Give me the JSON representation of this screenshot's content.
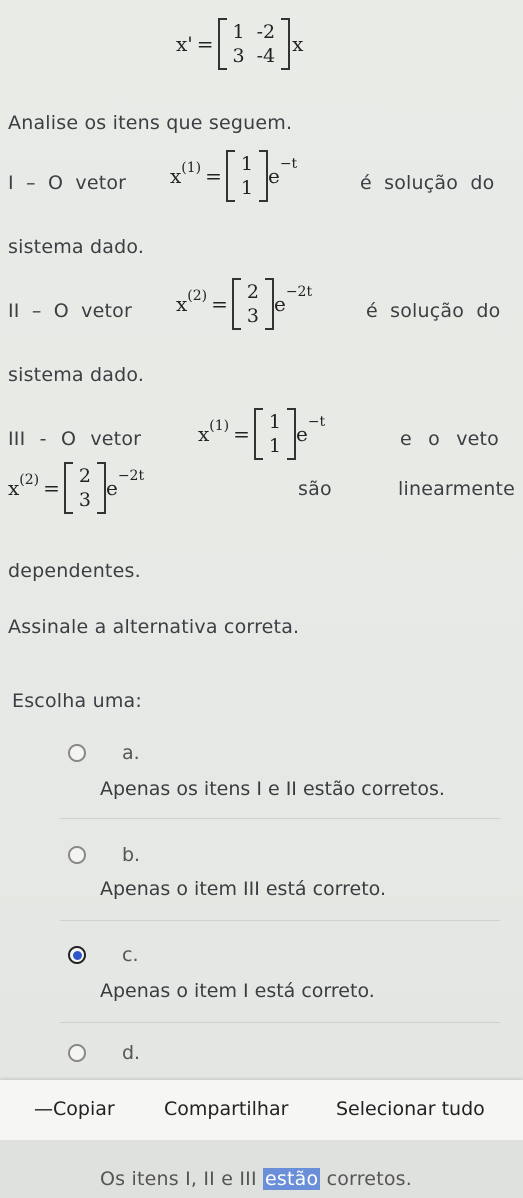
{
  "equation": {
    "lhs": "x'",
    "eq": "=",
    "matrix": [
      [
        "1",
        "-2"
      ],
      [
        "3",
        "-4"
      ]
    ],
    "rhs": "x"
  },
  "intro": "Analise os itens que seguem.",
  "item1": {
    "prefix": "I – O vetor",
    "sym": "x",
    "sup": "(1)",
    "eq": "=",
    "vec": [
      "1",
      "1"
    ],
    "exp_base": "e",
    "exp": "−t",
    "suffix": "é solução do",
    "line2": "sistema dado."
  },
  "item2": {
    "prefix": "II – O vetor",
    "sym": "x",
    "sup": "(2)",
    "eq": "=",
    "vec": [
      "2",
      "3"
    ],
    "exp_base": "e",
    "exp": "−2t",
    "suffix": "é solução do",
    "line2": "sistema dado."
  },
  "item3": {
    "prefix": "III - O vetor",
    "sym": "x",
    "sup": "(1)",
    "eq": "=",
    "vec": [
      "1",
      "1"
    ],
    "exp_base": "e",
    "exp": "−t",
    "suffix": "e o veto",
    "sym2": "x",
    "sup2": "(2)",
    "eq2": "=",
    "vec2": [
      "2",
      "3"
    ],
    "exp2": "−2t",
    "mid": "são",
    "right": "linearmente",
    "line3": "dependentes."
  },
  "instruction": "Assinale a alternativa correta.",
  "choose": "Escolha uma:",
  "options": [
    {
      "letter": "a.",
      "text": "Apenas os itens I e II estão corretos.",
      "selected": false
    },
    {
      "letter": "b.",
      "text": "Apenas o item III está correto.",
      "selected": false
    },
    {
      "letter": "c.",
      "text": "Apenas o item I está correto.",
      "selected": true
    },
    {
      "letter": "d.",
      "text": "",
      "selected": false
    }
  ],
  "context_menu": {
    "copy": "Copiar",
    "share": "Compartilhar",
    "select_all": "Selecionar tudo"
  },
  "partial_text": {
    "before": "Os itens I, II e III ",
    "highlight": "estão",
    "after": " corretos."
  },
  "colors": {
    "accent": "#2f57c9",
    "highlight": "#6a8fd8"
  }
}
